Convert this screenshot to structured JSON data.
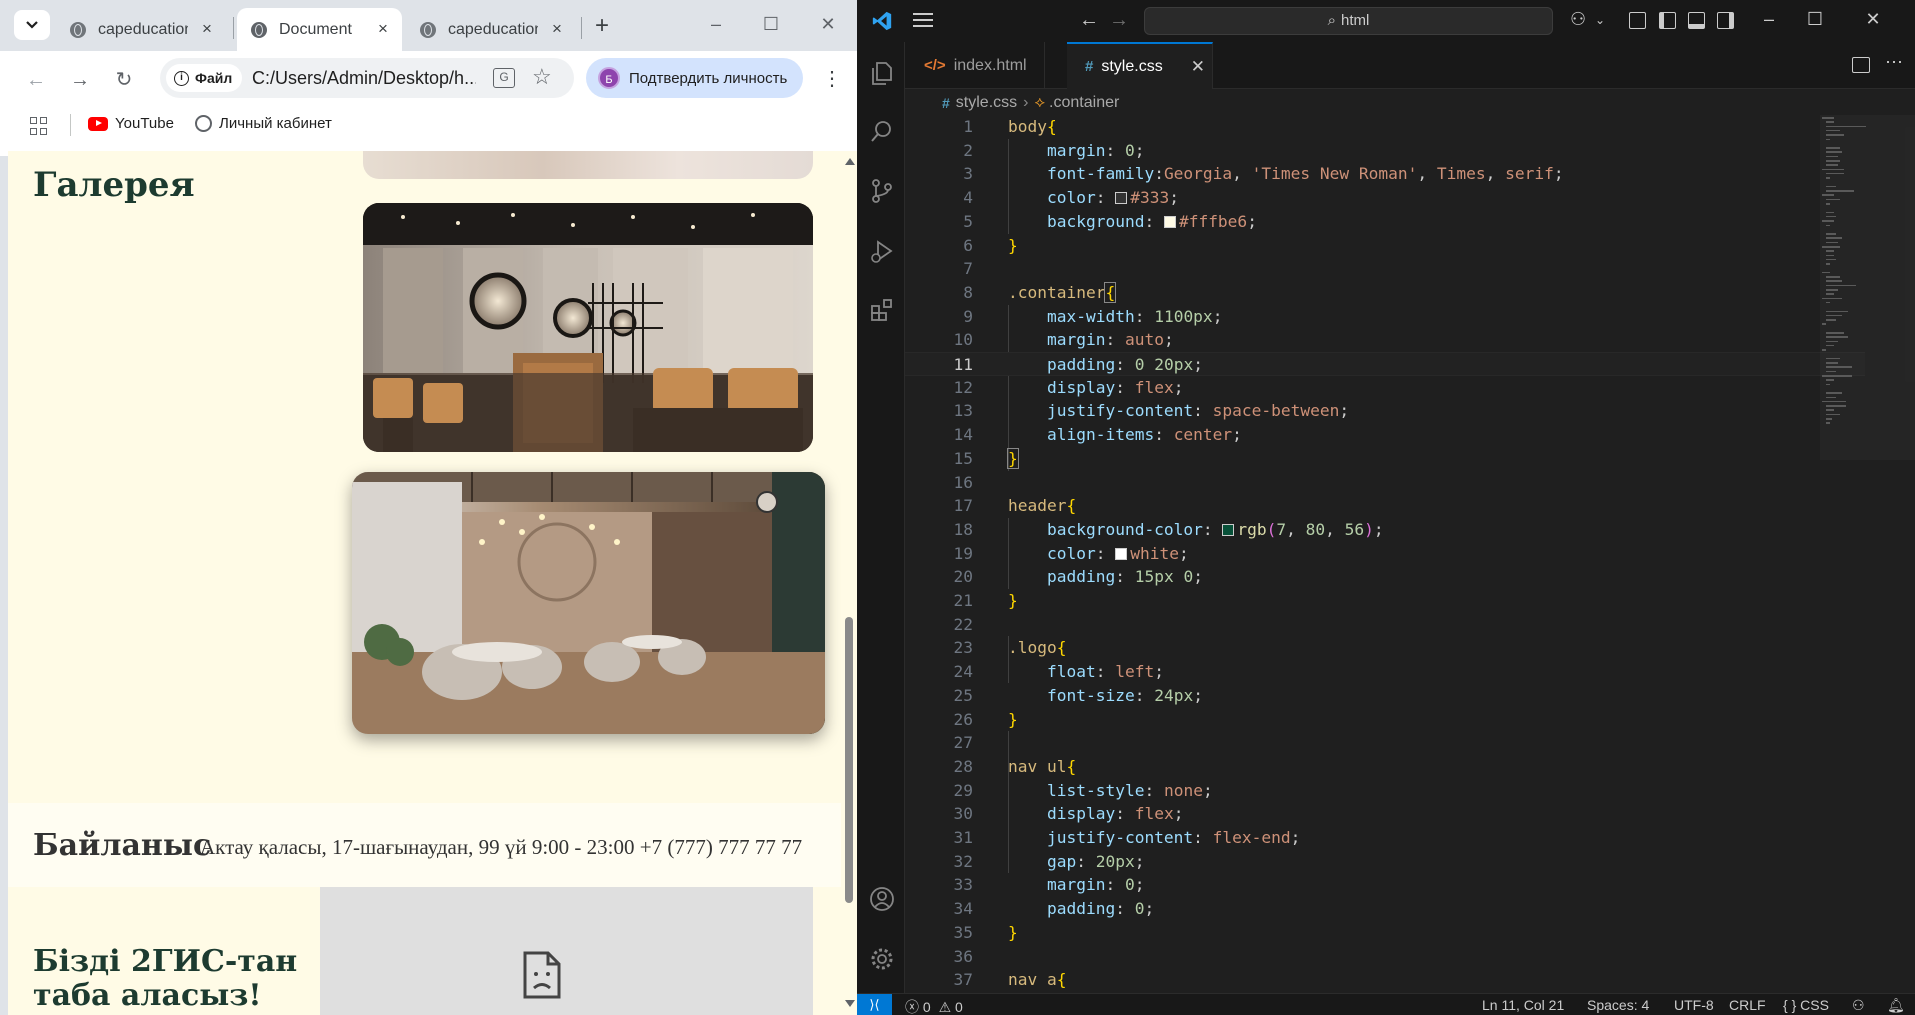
{
  "browser": {
    "tabs": [
      {
        "label": "capeducation",
        "active": false
      },
      {
        "label": "Document",
        "active": true
      },
      {
        "label": "capeducation",
        "active": false
      }
    ],
    "site_chip": "Файл",
    "url": "C:/Users/Admin/Desktop/h...",
    "verify_label": "Подтвердить личность",
    "avatar_letter": "Б",
    "bookmarks": [
      {
        "label": "YouTube"
      },
      {
        "label": "Личный кабинет"
      }
    ],
    "page": {
      "gallery_title": "Галерея",
      "contact_title": "Байланыс",
      "contact_text": "Актау қаласы, 17-шағынаудан, 99 үй 9:00 - 23:00 +7 (777) 777 77 77",
      "map_title": "Бізді 2ГИС-тан табa аласыз!"
    }
  },
  "vscode": {
    "search": "html",
    "tabs": [
      {
        "label": "index.html",
        "icon": "html-icon",
        "active": false
      },
      {
        "label": "style.css",
        "icon": "css-icon",
        "active": true
      }
    ],
    "breadcrumbs": [
      "style.css",
      ".container"
    ],
    "current_line": 11,
    "status": {
      "errors": "0",
      "warnings": "0",
      "position": "Ln 11, Col 21",
      "spaces": "Spaces: 4",
      "encoding": "UTF-8",
      "eol": "CRLF",
      "language": "CSS"
    }
  },
  "colors": {
    "page_bg": "#fffbe6",
    "header_green": "#075038",
    "vscode_accent": "#0078d4"
  }
}
